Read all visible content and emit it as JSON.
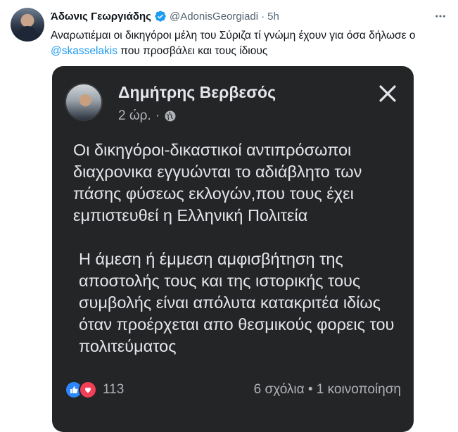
{
  "tweet": {
    "author_name": "Άδωνις Γεωργιάδης",
    "handle": "@AdonisGeorgiadi",
    "separator": "·",
    "time": "5h",
    "more_icon": "more-dots-icon",
    "text_before": "Αναρωτιέμαι οι δικηγόροι μέλη του Σύριζα τί γνώμη έχουν για όσα δήλωσε ο ",
    "mention": "@skasselakis",
    "text_after": " που προσβάλει και τους ίδιους",
    "colors": {
      "accent": "#1d9bf0",
      "text": "#0f1419",
      "muted": "#536471"
    }
  },
  "embedded_post": {
    "author_name": "Δημήτρης Βερβεσός",
    "time": "2 ώρ.",
    "separator": "·",
    "privacy_icon": "globe-icon",
    "close_icon": "close-icon",
    "paragraphs": [
      "Οι δικηγόροι-δικαστικοί αντιπρόσωποι διαχρονικα εγγυώνται το αδιάβλητο των πάσης φύσεως εκλογών,που τους έχει εμπιστευθεί η Ελληνική Πολιτεία",
      "Η άμεση ή έμμεση αμφισβήτηση της αποστολής τους και της ιστορικής τους συμβολής είναι απόλυτα κατακριτέα ιδίως όταν προέρχεται απο θεσμικούς φορεις του πολιτεύματος"
    ],
    "reactions_count": "113",
    "comments_shares": "6 σχόλια • 1 κοινοποίηση",
    "colors": {
      "background": "#242526",
      "text": "#e4e6eb",
      "muted": "#b0b3b8",
      "like": "#2d88ff",
      "love": "#f33e58"
    }
  }
}
